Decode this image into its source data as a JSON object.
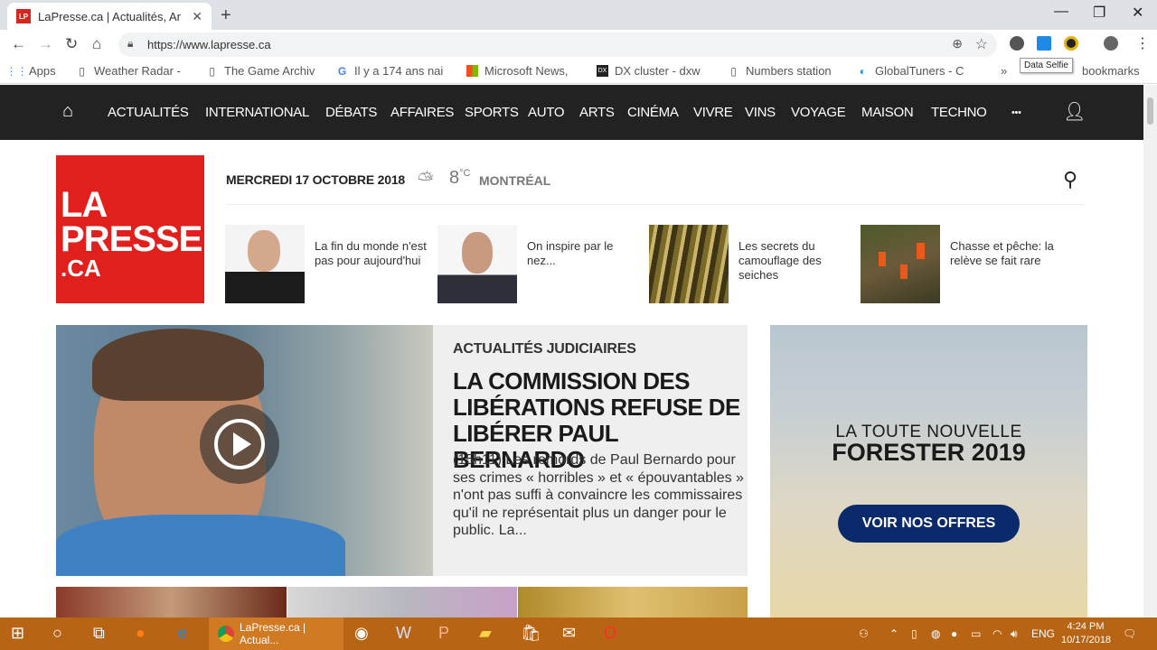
{
  "browser": {
    "tab_title": "LaPresse.ca | Actualités, Ar",
    "favicon_text": "LP",
    "url": "https://www.lapresse.ca",
    "tooltip": "Data Selfie"
  },
  "bookmarks": {
    "items": [
      "Apps",
      "Weather Radar -",
      "The Game Archiv",
      "Il y a 174 ans nai",
      "Microsoft News,",
      "DX cluster - dxw",
      "Numbers station",
      "GlobalTuners - C"
    ],
    "overflow": "»",
    "other": "bookmarks"
  },
  "sitenav": {
    "items": [
      "ACTUALITÉS",
      "INTERNATIONAL",
      "DÉBATS",
      "AFFAIRES",
      "SPORTS",
      "AUTO",
      "ARTS",
      "CINÉMA",
      "VIVRE",
      "VINS",
      "VOYAGE",
      "MAISON",
      "TECHNO"
    ],
    "more": "•••"
  },
  "header": {
    "logo_line1": "LA",
    "logo_line2": "PRESSE",
    "logo_line3": ".CA",
    "date": "MERCREDI 17 OCTOBRE 2018",
    "temp_value": "8",
    "temp_unit": "°C",
    "city": "MONTRÉAL"
  },
  "teasers": [
    {
      "text": "La fin du monde n'est pas pour aujourd'hui"
    },
    {
      "text": "On inspire par le nez..."
    },
    {
      "text": "Les secrets du camouflage des seiches"
    },
    {
      "text": "Chasse et pêche: la relève se fait rare"
    }
  ],
  "main_story": {
    "category": "ACTUALITÉS JUDICIAIRES",
    "title": "LA COMMISSION DES LIBÉRATIONS REFUSE DE LIBÉRER PAUL BERNARDO",
    "body": "(15h11) Les remords de Paul Bernardo pour ses crimes « horribles » et « épouvantables » n'ont pas suffi à convaincre les commissaires qu'il ne représentait plus un danger pour le public. La..."
  },
  "ad": {
    "line1": "LA TOUTE NOUVELLE",
    "line2": "FORESTER 2019",
    "cta": "VOIR NOS OFFRES"
  },
  "taskbar": {
    "active_app": "LaPresse.ca | Actual...",
    "lang": "ENG",
    "time": "4:24 PM",
    "date": "10/17/2018"
  },
  "colors": {
    "brand_red": "#e1201d",
    "nav_bg": "#222222",
    "taskbar": "#b76515",
    "ad_cta": "#0b2a6b"
  }
}
